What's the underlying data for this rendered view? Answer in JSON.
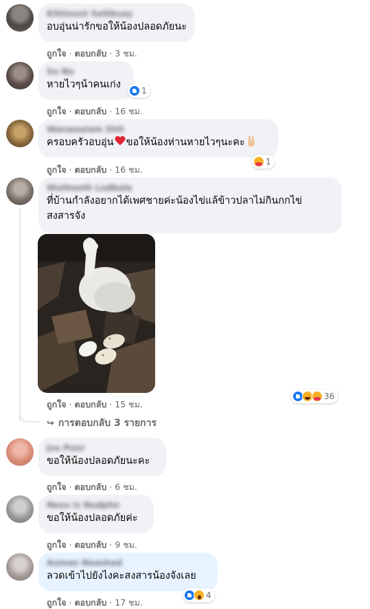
{
  "colors": {
    "bubble": "#f0f2f5",
    "bubble_highlight": "#e7f3ff",
    "meta_text": "#65676b",
    "like_blue": "#1877f2"
  },
  "actions": {
    "like": "ถูกใจ",
    "reply": "ตอบกลับ"
  },
  "comments": [
    {
      "author": "Kittinunt Settbuay",
      "text": "อบอุ่นน่ารักขอให้น้องปลอดภัยนะ",
      "time": "3 ชม."
    },
    {
      "author": "Su Nu",
      "text": "หายไวๆน้าคนเก่ง",
      "time": "16 ชม.",
      "reactions": {
        "icons": [
          "like-icon"
        ],
        "count": "1"
      }
    },
    {
      "author": "Wanwaaiam Shit",
      "text_before": "ครอบครัวอบอุ่น",
      "text_emoji": "red-heart",
      "text_after": "ขอให้น้องห่านหายไวๆนะคะ",
      "text_emoji_end": "victory-hand",
      "time": "16 ชม.",
      "reactions": {
        "icons": [
          "care-icon"
        ],
        "count": "1"
      }
    },
    {
      "author": "Wuthoeth Lodbala",
      "text": "ที่บ้านกำลังอยากได้เพศชายค่ะน้องไข่แล้ข้าวปลาไม่กินกกไข่\nสงสารจัง",
      "time": "15 ชม.",
      "reactions": {
        "icons": [
          "like-icon",
          "haha-icon",
          "care-icon"
        ],
        "count": "36"
      },
      "replies_link": "การตอบกลับ 3 รายการ"
    },
    {
      "author": "Jsu Punr",
      "text": "ขอให้น้องปลอดภัยนะคะ",
      "time": "6 ชม."
    },
    {
      "author": "Nesu is Nudphn",
      "text": "ขอให้น้องปลอดภัยค่ะ",
      "time": "9 ชม."
    },
    {
      "author": "Auman Noashed",
      "text": "ลวดเข้าไปยังไงคะสงสารน้องจังเลย",
      "time": "17 ชม.",
      "reactions": {
        "icons": [
          "like-icon",
          "wow-icon"
        ],
        "count": "4"
      }
    }
  ]
}
